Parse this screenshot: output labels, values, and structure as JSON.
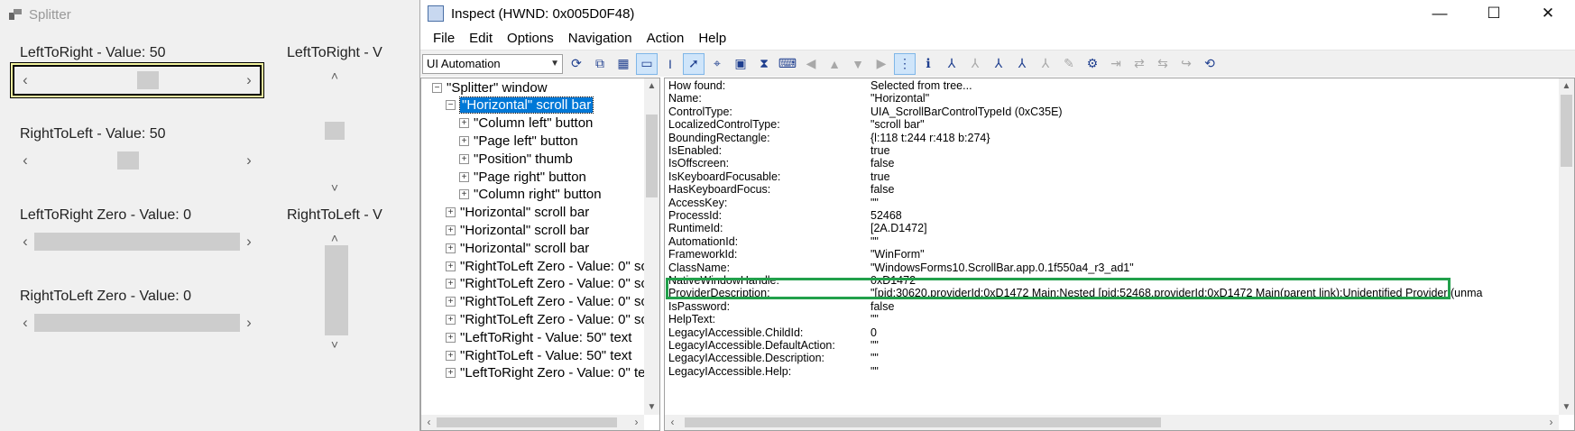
{
  "splitter": {
    "title": "Splitter",
    "labels": [
      "LeftToRight - Value: 50",
      "RightToLeft - Value: 50",
      "LeftToRight Zero - Value: 0",
      "RightToLeft Zero - Value: 0",
      "LeftToRight - V",
      "RightToLeft - V"
    ],
    "scrollbars": [
      {
        "orientation": "horizontal",
        "value_fraction": 0.5,
        "focused": true
      },
      {
        "orientation": "horizontal",
        "value_fraction": 0.5,
        "focused": false
      },
      {
        "orientation": "horizontal",
        "value_fraction": 0.0,
        "focused": false
      },
      {
        "orientation": "horizontal",
        "value_fraction": 0.0,
        "focused": false
      },
      {
        "orientation": "vertical",
        "value_fraction": 0.5,
        "focused": false
      },
      {
        "orientation": "vertical",
        "value_fraction": 0.0,
        "focused": false
      }
    ],
    "arrows": {
      "left": "‹",
      "right": "›",
      "up": "˄",
      "down": "˅"
    }
  },
  "inspect": {
    "title": "Inspect  (HWND: 0x005D0F48)",
    "window_buttons": {
      "minimize": "—",
      "maximize": "☐",
      "close": "✕"
    },
    "menu": [
      "File",
      "Edit",
      "Options",
      "Navigation",
      "Action",
      "Help"
    ],
    "mode_combo": "UI Automation",
    "tree": [
      {
        "label": "\"Splitter\" window",
        "expander": "−",
        "indent": 1
      },
      {
        "label": "\"Horizontal\" scroll bar",
        "expander": "−",
        "indent": 2,
        "selected": true
      },
      {
        "label": "\"Column left\" button",
        "expander": "+",
        "indent": 3
      },
      {
        "label": "\"Page left\" button",
        "expander": "+",
        "indent": 3
      },
      {
        "label": "\"Position\" thumb",
        "expander": "+",
        "indent": 3
      },
      {
        "label": "\"Page right\" button",
        "expander": "+",
        "indent": 3
      },
      {
        "label": "\"Column right\" button",
        "expander": "+",
        "indent": 3
      },
      {
        "label": "\"Horizontal\" scroll bar",
        "expander": "+",
        "indent": 2
      },
      {
        "label": "\"Horizontal\" scroll bar",
        "expander": "+",
        "indent": 2
      },
      {
        "label": "\"Horizontal\" scroll bar",
        "expander": "+",
        "indent": 2
      },
      {
        "label": "\"RightToLeft Zero - Value: 0\" sc",
        "expander": "+",
        "indent": 2
      },
      {
        "label": "\"RightToLeft Zero - Value: 0\" sc",
        "expander": "+",
        "indent": 2
      },
      {
        "label": "\"RightToLeft Zero - Value: 0\" sc",
        "expander": "+",
        "indent": 2
      },
      {
        "label": "\"RightToLeft Zero - Value: 0\" sc",
        "expander": "+",
        "indent": 2
      },
      {
        "label": "\"LeftToRight - Value: 50\" text",
        "expander": "+",
        "indent": 2
      },
      {
        "label": "\"RightToLeft - Value: 50\" text",
        "expander": "+",
        "indent": 2
      },
      {
        "label": "\"LeftToRight Zero - Value: 0\" te",
        "expander": "+",
        "indent": 2
      }
    ],
    "properties": [
      {
        "key": "How found:",
        "value": "Selected from tree..."
      },
      {
        "key": "Name:",
        "value": "\"Horizontal\""
      },
      {
        "key": "ControlType:",
        "value": "UIA_ScrollBarControlTypeId (0xC35E)"
      },
      {
        "key": "LocalizedControlType:",
        "value": "\"scroll bar\""
      },
      {
        "key": "BoundingRectangle:",
        "value": "{l:118 t:244 r:418 b:274}"
      },
      {
        "key": "IsEnabled:",
        "value": "true"
      },
      {
        "key": "IsOffscreen:",
        "value": "false"
      },
      {
        "key": "IsKeyboardFocusable:",
        "value": "true"
      },
      {
        "key": "HasKeyboardFocus:",
        "value": "false"
      },
      {
        "key": "AccessKey:",
        "value": "\"\""
      },
      {
        "key": "ProcessId:",
        "value": "52468"
      },
      {
        "key": "RuntimeId:",
        "value": "[2A.D1472]"
      },
      {
        "key": "AutomationId:",
        "value": "\"\""
      },
      {
        "key": "FrameworkId:",
        "value": "\"WinForm\""
      },
      {
        "key": "ClassName:",
        "value": "\"WindowsForms10.ScrollBar.app.0.1f550a4_r3_ad1\""
      },
      {
        "key": "NativeWindowHandle:",
        "value": "0xD1472"
      },
      {
        "key": "ProviderDescription:",
        "value": "\"[pid:30620,providerId:0xD1472 Main:Nested [pid:52468,providerId:0xD1472 Main(parent link):Unidentified Provider (unma",
        "highlighted": true
      },
      {
        "key": "IsPassword:",
        "value": "false"
      },
      {
        "key": "HelpText:",
        "value": "\"\""
      },
      {
        "key": "LegacyIAccessible.ChildId:",
        "value": "0"
      },
      {
        "key": "LegacyIAccessible.DefaultAction:",
        "value": "\"\""
      },
      {
        "key": "LegacyIAccessible.Description:",
        "value": "\"\""
      },
      {
        "key": "LegacyIAccessible.Help:",
        "value": "\"\""
      }
    ],
    "colors": {
      "highlight_box": "#22a04b",
      "selection": "#0078d7"
    }
  }
}
